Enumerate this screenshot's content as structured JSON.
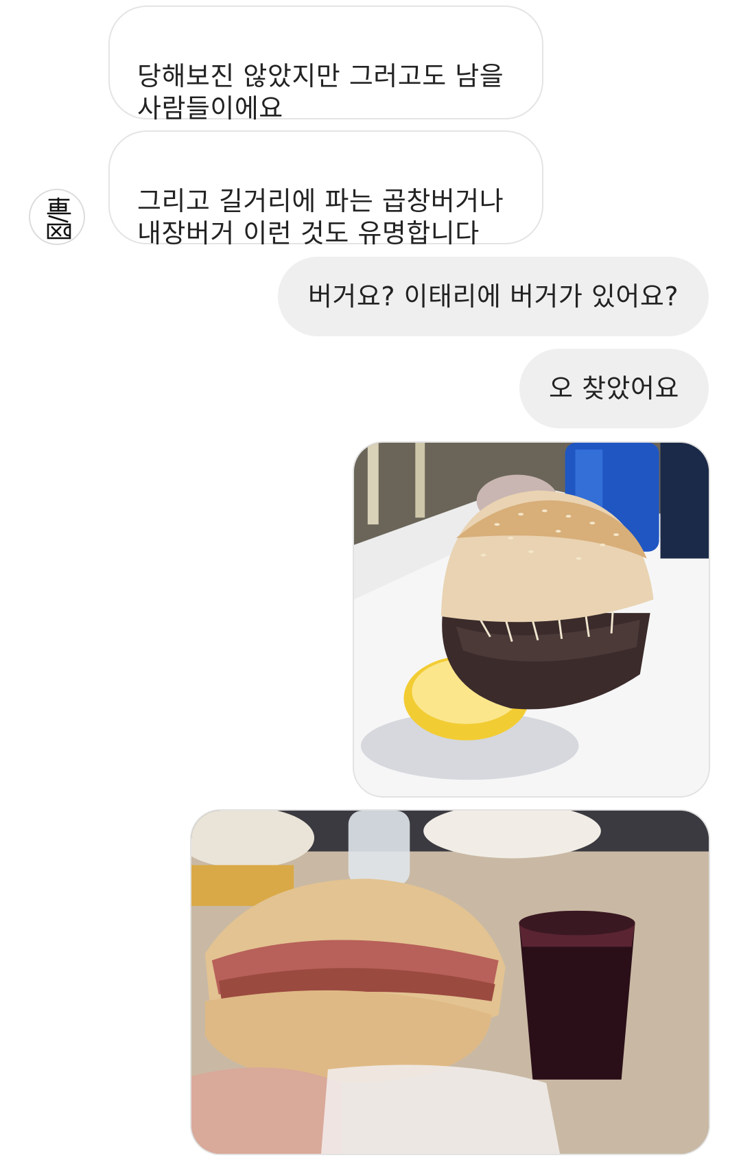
{
  "messages": [
    {
      "direction": "incoming",
      "text": "당해보진 않았지만 그러고도 남을\n사람들이에요"
    },
    {
      "direction": "incoming",
      "text": "그리고 길거리에 파는 곱창버거나\n내장버거 이런 것도 유명합니다"
    },
    {
      "direction": "outgoing",
      "text": "버거요? 이태리에 버거가 있어요?"
    },
    {
      "direction": "outgoing",
      "text": "오 찾았어요"
    }
  ],
  "photos": [
    {
      "direction": "outgoing",
      "subject": "sesame-bun-offal-burger-with-lemon"
    },
    {
      "direction": "outgoing",
      "subject": "burger-in-hand-with-glass-of-wine"
    }
  ],
  "avatar": {
    "icon": "calligraphy-seal-avatar"
  },
  "colors": {
    "incoming_bubble_bg": "#ffffff",
    "incoming_bubble_border": "#e4e4e4",
    "outgoing_bubble_bg": "#efefef",
    "text": "#222222"
  }
}
